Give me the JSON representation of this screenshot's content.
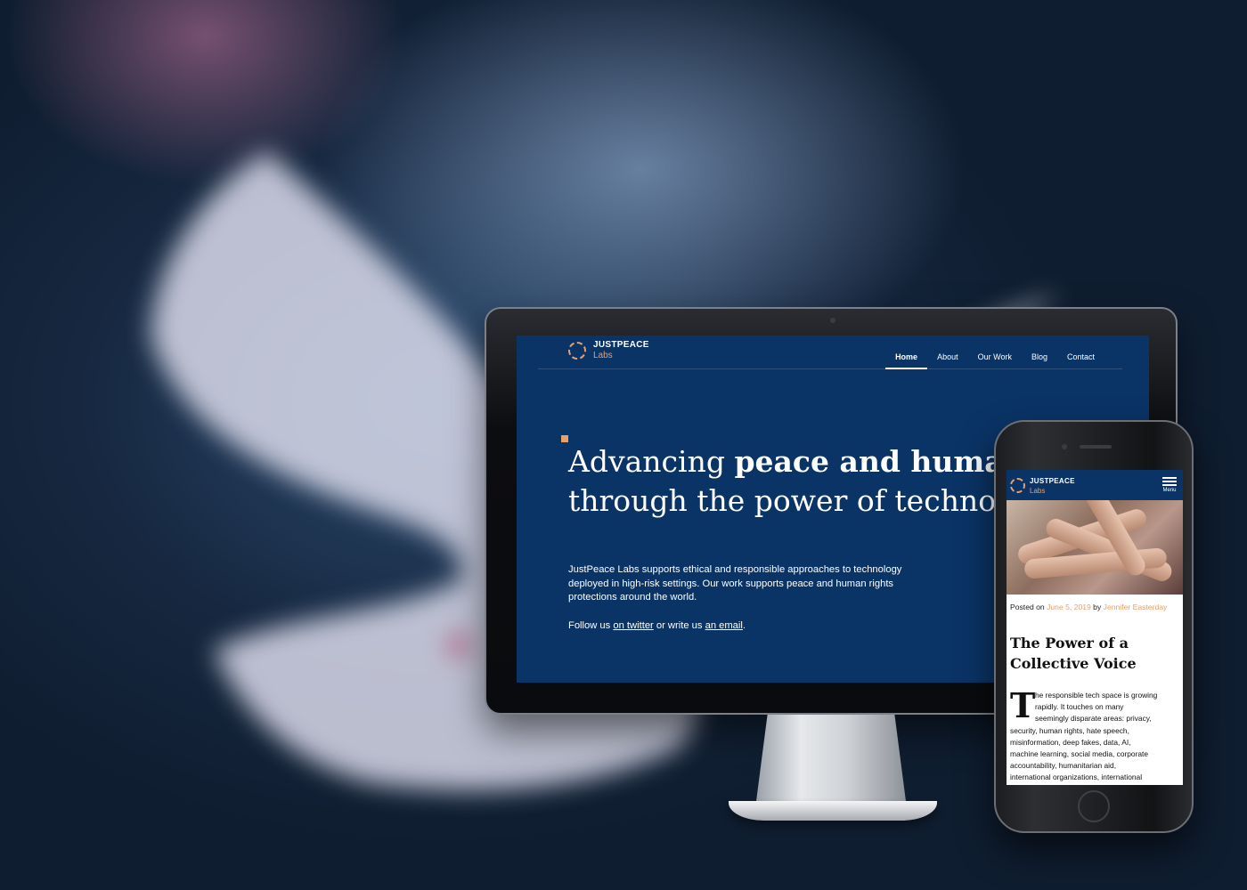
{
  "colors": {
    "site_navy": "#0a3466",
    "accent_orange": "#e7a06a"
  },
  "desktop": {
    "logo": {
      "title": "JUSTPEACE",
      "subtitle": "Labs",
      "icon": "logo-ring-icon"
    },
    "nav": [
      {
        "label": "Home",
        "active": true
      },
      {
        "label": "About"
      },
      {
        "label": "Our Work"
      },
      {
        "label": "Blog"
      },
      {
        "label": "Contact"
      }
    ],
    "hero": {
      "title_light": "Advancing ",
      "title_bold": "peace and human",
      "title_line2": "through the power of technolo",
      "body": "JustPeace Labs supports ethical and responsible approaches to technology deployed in high-risk settings. Our work supports peace and human rights protections around the world.",
      "follow_prefix": "Follow us ",
      "twitter_link": "on twitter",
      "follow_middle": " or write us ",
      "email_link": "an email",
      "follow_suffix": "."
    }
  },
  "mobile": {
    "logo": {
      "title": "JUSTPEACE",
      "subtitle": "Labs"
    },
    "menu_label": "Menu",
    "post": {
      "posted_on": "Posted on ",
      "date": "June 5, 2019",
      "by": " by ",
      "author": "Jennifer Easterday",
      "title": "The Power of a Collective Voice",
      "dropcap": "T",
      "lines": [
        "he responsible tech space is growing",
        "rapidly. It touches on many",
        "seemingly disparate areas: privacy,",
        "security, human rights, hate speech,",
        "misinformation, deep fakes, data, AI,",
        "machine learning, social media, corporate",
        "accountability, humanitarian aid,",
        "international organizations, international"
      ]
    }
  }
}
